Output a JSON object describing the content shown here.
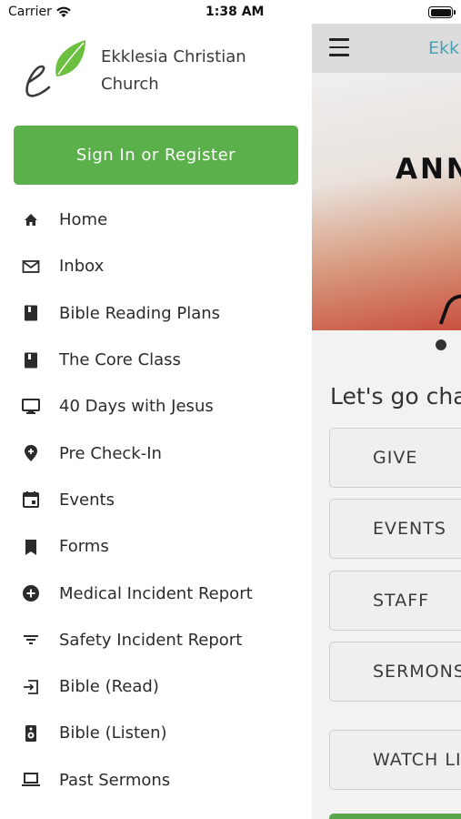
{
  "status_bar": {
    "carrier": "Carrier",
    "time": "1:38 AM"
  },
  "drawer": {
    "church_name_line1": "Ekklesia Christian",
    "church_name_line2": "Church",
    "signin_label": "Sign In or Register",
    "items": [
      {
        "label": "Home",
        "icon": "home-icon"
      },
      {
        "label": "Inbox",
        "icon": "mail-icon"
      },
      {
        "label": "Bible Reading Plans",
        "icon": "book-icon"
      },
      {
        "label": "The Core Class",
        "icon": "book-icon"
      },
      {
        "label": "40 Days with Jesus",
        "icon": "monitor-icon"
      },
      {
        "label": "Pre Check-In",
        "icon": "location-pin-icon"
      },
      {
        "label": "Events",
        "icon": "calendar-icon"
      },
      {
        "label": "Forms",
        "icon": "bookmark-icon"
      },
      {
        "label": "Medical Incident Report",
        "icon": "plus-circle-icon"
      },
      {
        "label": "Safety Incident Report",
        "icon": "filter-icon"
      },
      {
        "label": "Bible (Read)",
        "icon": "login-icon"
      },
      {
        "label": "Bible (Listen)",
        "icon": "speaker-icon"
      },
      {
        "label": "Past Sermons",
        "icon": "laptop-icon"
      }
    ]
  },
  "background_app": {
    "title": "Ekk",
    "banner_text": "ANN",
    "headline": "Let's go cha",
    "buttons": [
      "GIVE",
      "EVENTS",
      "STAFF",
      "SERMONS",
      "WATCH LI"
    ]
  },
  "colors": {
    "accent_green": "#5cb04c",
    "title_teal": "#4aa0b8"
  }
}
